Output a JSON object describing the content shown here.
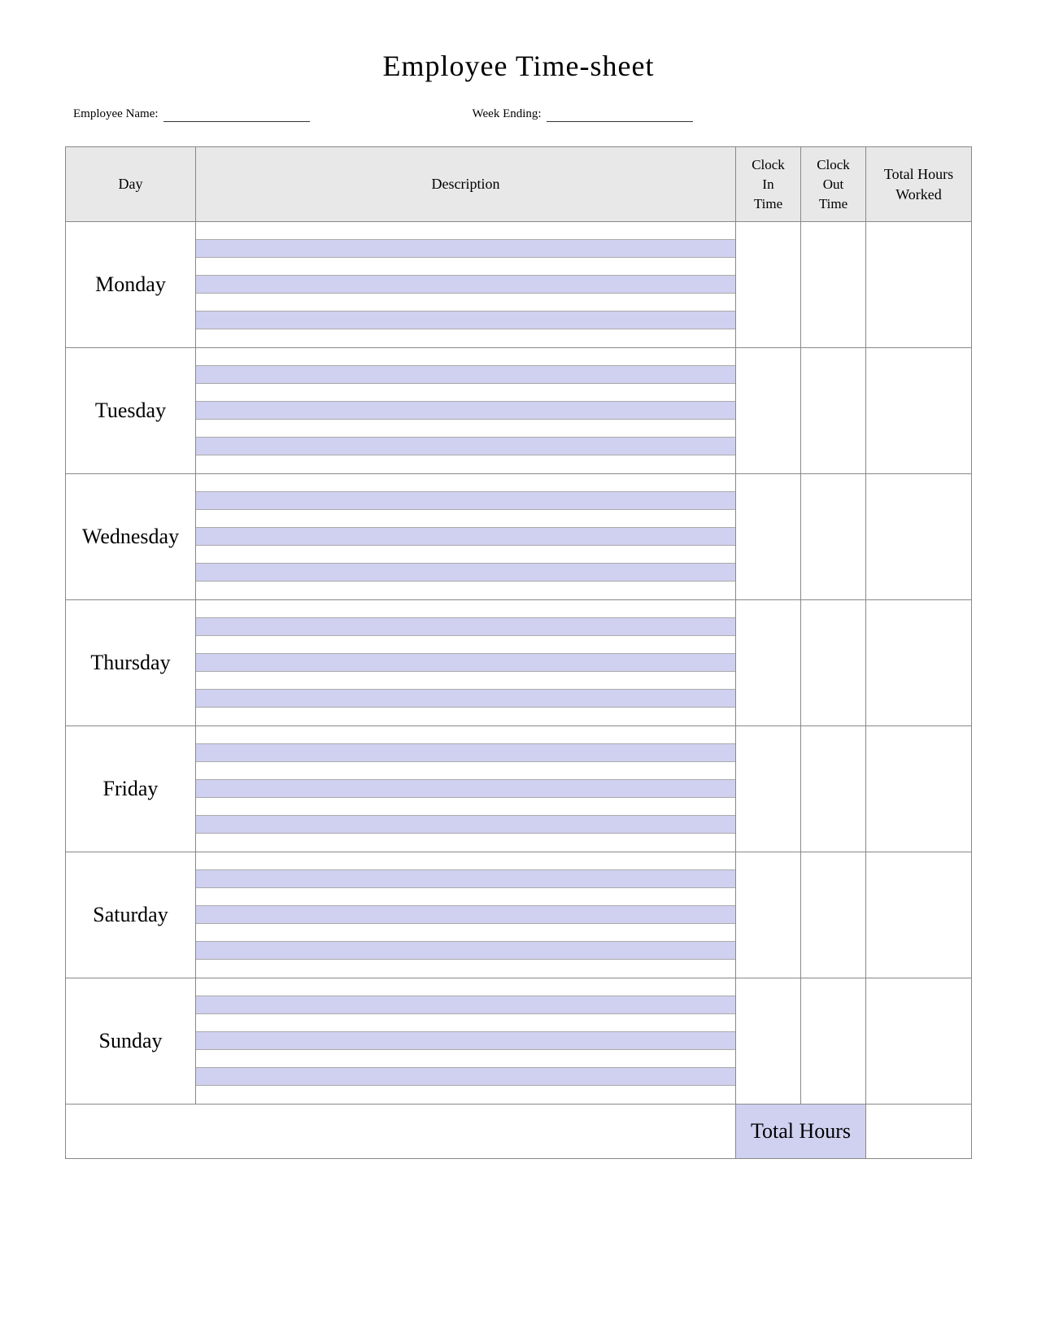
{
  "title": "Employee Time-sheet",
  "meta": {
    "employee_label": "Employee Name:",
    "week_label": "Week Ending:"
  },
  "table": {
    "headers": {
      "day": "Day",
      "description": "Description",
      "clock_in": "Clock\nIn\nTime",
      "clock_out": "Clock\nOut\nTime",
      "total_hours_worked": "Total Hours Worked"
    },
    "days": [
      "Monday",
      "Tuesday",
      "Wednesday",
      "Thursday",
      "Friday",
      "Saturday",
      "Sunday"
    ],
    "total_hours_label": "Total Hours"
  }
}
